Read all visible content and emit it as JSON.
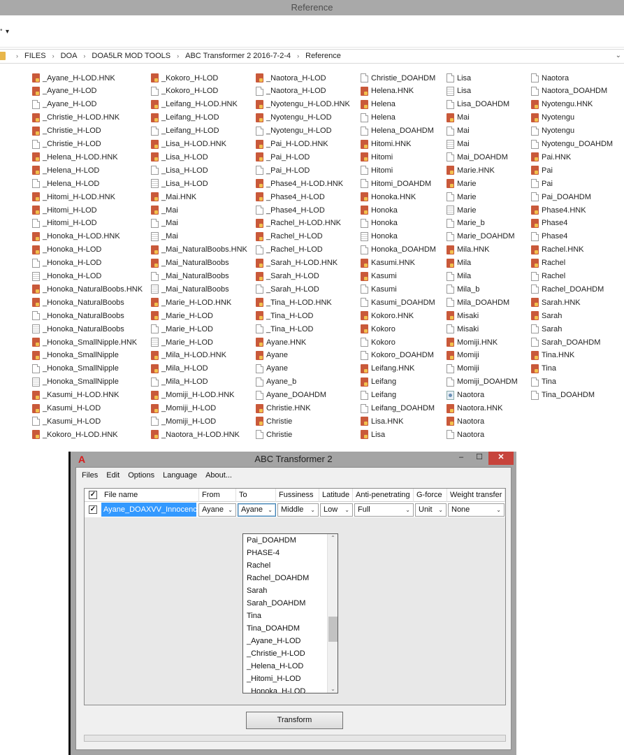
{
  "explorer": {
    "title": "Reference",
    "breadcrumb": [
      "FILES",
      "DOA",
      "DOA5LR MOD TOOLS",
      "ABC Transformer 2 2016-7-2-4",
      "Reference"
    ]
  },
  "files": [
    [
      {
        "name": "_Ayane_H-LOD.HNK",
        "icon": "hnk"
      },
      {
        "name": "_Ayane_H-LOD",
        "icon": "hnk"
      },
      {
        "name": "_Ayane_H-LOD",
        "icon": "file"
      },
      {
        "name": "_Christie_H-LOD.HNK",
        "icon": "hnk"
      },
      {
        "name": "_Christie_H-LOD",
        "icon": "hnk"
      },
      {
        "name": "_Christie_H-LOD",
        "icon": "file"
      },
      {
        "name": "_Helena_H-LOD.HNK",
        "icon": "hnk"
      },
      {
        "name": "_Helena_H-LOD",
        "icon": "hnk"
      },
      {
        "name": "_Helena_H-LOD",
        "icon": "file"
      },
      {
        "name": "_Hitomi_H-LOD.HNK",
        "icon": "hnk"
      },
      {
        "name": "_Hitomi_H-LOD",
        "icon": "hnk"
      },
      {
        "name": "_Hitomi_H-LOD",
        "icon": "file"
      },
      {
        "name": "_Honoka_H-LOD.HNK",
        "icon": "hnk"
      },
      {
        "name": "_Honoka_H-LOD",
        "icon": "hnk"
      },
      {
        "name": "_Honoka_H-LOD",
        "icon": "file"
      },
      {
        "name": "_Honoka_H-LOD",
        "icon": "doc"
      },
      {
        "name": "_Honoka_NaturalBoobs.HNK",
        "icon": "hnk"
      },
      {
        "name": "_Honoka_NaturalBoobs",
        "icon": "hnk"
      },
      {
        "name": "_Honoka_NaturalBoobs",
        "icon": "file"
      },
      {
        "name": "_Honoka_NaturalBoobs",
        "icon": "doc"
      },
      {
        "name": "_Honoka_SmallNipple.HNK",
        "icon": "hnk"
      },
      {
        "name": "_Honoka_SmallNipple",
        "icon": "hnk"
      },
      {
        "name": "_Honoka_SmallNipple",
        "icon": "file"
      },
      {
        "name": "_Honoka_SmallNipple",
        "icon": "doc"
      },
      {
        "name": "_Kasumi_H-LOD.HNK",
        "icon": "hnk"
      },
      {
        "name": "_Kasumi_H-LOD",
        "icon": "hnk"
      },
      {
        "name": "_Kasumi_H-LOD",
        "icon": "file"
      },
      {
        "name": "_Kokoro_H-LOD.HNK",
        "icon": "hnk"
      }
    ],
    [
      {
        "name": "_Kokoro_H-LOD",
        "icon": "hnk"
      },
      {
        "name": "_Kokoro_H-LOD",
        "icon": "file"
      },
      {
        "name": "_Leifang_H-LOD.HNK",
        "icon": "hnk"
      },
      {
        "name": "_Leifang_H-LOD",
        "icon": "hnk"
      },
      {
        "name": "_Leifang_H-LOD",
        "icon": "file"
      },
      {
        "name": "_Lisa_H-LOD.HNK",
        "icon": "hnk"
      },
      {
        "name": "_Lisa_H-LOD",
        "icon": "hnk"
      },
      {
        "name": "_Lisa_H-LOD",
        "icon": "file"
      },
      {
        "name": "_Lisa_H-LOD",
        "icon": "doc"
      },
      {
        "name": "_Mai.HNK",
        "icon": "hnk"
      },
      {
        "name": "_Mai",
        "icon": "hnk"
      },
      {
        "name": "_Mai",
        "icon": "file"
      },
      {
        "name": "_Mai",
        "icon": "doc"
      },
      {
        "name": "_Mai_NaturalBoobs.HNK",
        "icon": "hnk"
      },
      {
        "name": "_Mai_NaturalBoobs",
        "icon": "hnk"
      },
      {
        "name": "_Mai_NaturalBoobs",
        "icon": "file"
      },
      {
        "name": "_Mai_NaturalBoobs",
        "icon": "doc"
      },
      {
        "name": "_Marie_H-LOD.HNK",
        "icon": "hnk"
      },
      {
        "name": "_Marie_H-LOD",
        "icon": "hnk"
      },
      {
        "name": "_Marie_H-LOD",
        "icon": "file"
      },
      {
        "name": "_Marie_H-LOD",
        "icon": "doc"
      },
      {
        "name": "_Mila_H-LOD.HNK",
        "icon": "hnk"
      },
      {
        "name": "_Mila_H-LOD",
        "icon": "hnk"
      },
      {
        "name": "_Mila_H-LOD",
        "icon": "file"
      },
      {
        "name": "_Momiji_H-LOD.HNK",
        "icon": "hnk"
      },
      {
        "name": "_Momiji_H-LOD",
        "icon": "hnk"
      },
      {
        "name": "_Momiji_H-LOD",
        "icon": "file"
      },
      {
        "name": "_Naotora_H-LOD.HNK",
        "icon": "hnk"
      }
    ],
    [
      {
        "name": "_Naotora_H-LOD",
        "icon": "hnk"
      },
      {
        "name": "_Naotora_H-LOD",
        "icon": "file"
      },
      {
        "name": "_Nyotengu_H-LOD.HNK",
        "icon": "hnk"
      },
      {
        "name": "_Nyotengu_H-LOD",
        "icon": "hnk"
      },
      {
        "name": "_Nyotengu_H-LOD",
        "icon": "file"
      },
      {
        "name": "_Pai_H-LOD.HNK",
        "icon": "hnk"
      },
      {
        "name": "_Pai_H-LOD",
        "icon": "hnk"
      },
      {
        "name": "_Pai_H-LOD",
        "icon": "file"
      },
      {
        "name": "_Phase4_H-LOD.HNK",
        "icon": "hnk"
      },
      {
        "name": "_Phase4_H-LOD",
        "icon": "hnk"
      },
      {
        "name": "_Phase4_H-LOD",
        "icon": "file"
      },
      {
        "name": "_Rachel_H-LOD.HNK",
        "icon": "hnk"
      },
      {
        "name": "_Rachel_H-LOD",
        "icon": "hnk"
      },
      {
        "name": "_Rachel_H-LOD",
        "icon": "file"
      },
      {
        "name": "_Sarah_H-LOD.HNK",
        "icon": "hnk"
      },
      {
        "name": "_Sarah_H-LOD",
        "icon": "hnk"
      },
      {
        "name": "_Sarah_H-LOD",
        "icon": "file"
      },
      {
        "name": "_Tina_H-LOD.HNK",
        "icon": "hnk"
      },
      {
        "name": "_Tina_H-LOD",
        "icon": "hnk"
      },
      {
        "name": "_Tina_H-LOD",
        "icon": "file"
      },
      {
        "name": "Ayane.HNK",
        "icon": "hnk"
      },
      {
        "name": "Ayane",
        "icon": "hnk"
      },
      {
        "name": "Ayane",
        "icon": "file"
      },
      {
        "name": "Ayane_b",
        "icon": "file"
      },
      {
        "name": "Ayane_DOAHDM",
        "icon": "file"
      },
      {
        "name": "Christie.HNK",
        "icon": "hnk"
      },
      {
        "name": "Christie",
        "icon": "hnk"
      },
      {
        "name": "Christie",
        "icon": "file"
      }
    ],
    [
      {
        "name": "Christie_DOAHDM",
        "icon": "file"
      },
      {
        "name": "Helena.HNK",
        "icon": "hnk"
      },
      {
        "name": "Helena",
        "icon": "hnk"
      },
      {
        "name": "Helena",
        "icon": "file"
      },
      {
        "name": "Helena_DOAHDM",
        "icon": "file"
      },
      {
        "name": "Hitomi.HNK",
        "icon": "hnk"
      },
      {
        "name": "Hitomi",
        "icon": "hnk"
      },
      {
        "name": "Hitomi",
        "icon": "file"
      },
      {
        "name": "Hitomi_DOAHDM",
        "icon": "file"
      },
      {
        "name": "Honoka.HNK",
        "icon": "hnk"
      },
      {
        "name": "Honoka",
        "icon": "hnk"
      },
      {
        "name": "Honoka",
        "icon": "file"
      },
      {
        "name": "Honoka",
        "icon": "doc"
      },
      {
        "name": "Honoka_DOAHDM",
        "icon": "file"
      },
      {
        "name": "Kasumi.HNK",
        "icon": "hnk"
      },
      {
        "name": "Kasumi",
        "icon": "hnk"
      },
      {
        "name": "Kasumi",
        "icon": "file"
      },
      {
        "name": "Kasumi_DOAHDM",
        "icon": "file"
      },
      {
        "name": "Kokoro.HNK",
        "icon": "hnk"
      },
      {
        "name": "Kokoro",
        "icon": "hnk"
      },
      {
        "name": "Kokoro",
        "icon": "file"
      },
      {
        "name": "Kokoro_DOAHDM",
        "icon": "file"
      },
      {
        "name": "Leifang.HNK",
        "icon": "hnk"
      },
      {
        "name": "Leifang",
        "icon": "hnk"
      },
      {
        "name": "Leifang",
        "icon": "file"
      },
      {
        "name": "Leifang_DOAHDM",
        "icon": "file"
      },
      {
        "name": "Lisa.HNK",
        "icon": "hnk"
      },
      {
        "name": "Lisa",
        "icon": "hnk"
      }
    ],
    [
      {
        "name": "Lisa",
        "icon": "file"
      },
      {
        "name": "Lisa",
        "icon": "doc"
      },
      {
        "name": "Lisa_DOAHDM",
        "icon": "file"
      },
      {
        "name": "Mai",
        "icon": "hnk"
      },
      {
        "name": "Mai",
        "icon": "file"
      },
      {
        "name": "Mai",
        "icon": "doc"
      },
      {
        "name": "Mai_DOAHDM",
        "icon": "file"
      },
      {
        "name": "Marie.HNK",
        "icon": "hnk"
      },
      {
        "name": "Marie",
        "icon": "hnk"
      },
      {
        "name": "Marie",
        "icon": "file"
      },
      {
        "name": "Marie",
        "icon": "doc"
      },
      {
        "name": "Marie_b",
        "icon": "file"
      },
      {
        "name": "Marie_DOAHDM",
        "icon": "file"
      },
      {
        "name": "Mila.HNK",
        "icon": "hnk"
      },
      {
        "name": "Mila",
        "icon": "hnk"
      },
      {
        "name": "Mila",
        "icon": "file"
      },
      {
        "name": "Mila_b",
        "icon": "file"
      },
      {
        "name": "Mila_DOAHDM",
        "icon": "file"
      },
      {
        "name": "Misaki",
        "icon": "hnk"
      },
      {
        "name": "Misaki",
        "icon": "file"
      },
      {
        "name": "Momiji.HNK",
        "icon": "hnk"
      },
      {
        "name": "Momiji",
        "icon": "hnk"
      },
      {
        "name": "Momiji",
        "icon": "file"
      },
      {
        "name": "Momiji_DOAHDM",
        "icon": "file"
      },
      {
        "name": "Naotora",
        "icon": "img"
      },
      {
        "name": "Naotora.HNK",
        "icon": "hnk"
      },
      {
        "name": "Naotora",
        "icon": "hnk"
      },
      {
        "name": "Naotora",
        "icon": "file"
      }
    ],
    [
      {
        "name": "Naotora",
        "icon": "file"
      },
      {
        "name": "Naotora_DOAHDM",
        "icon": "file"
      },
      {
        "name": "Nyotengu.HNK",
        "icon": "hnk"
      },
      {
        "name": "Nyotengu",
        "icon": "hnk"
      },
      {
        "name": "Nyotengu",
        "icon": "file"
      },
      {
        "name": "Nyotengu_DOAHDM",
        "icon": "file"
      },
      {
        "name": "Pai.HNK",
        "icon": "hnk"
      },
      {
        "name": "Pai",
        "icon": "hnk"
      },
      {
        "name": "Pai",
        "icon": "file"
      },
      {
        "name": "Pai_DOAHDM",
        "icon": "file"
      },
      {
        "name": "Phase4.HNK",
        "icon": "hnk"
      },
      {
        "name": "Phase4",
        "icon": "hnk"
      },
      {
        "name": "Phase4",
        "icon": "file"
      },
      {
        "name": "Rachel.HNK",
        "icon": "hnk"
      },
      {
        "name": "Rachel",
        "icon": "hnk"
      },
      {
        "name": "Rachel",
        "icon": "file"
      },
      {
        "name": "Rachel_DOAHDM",
        "icon": "file"
      },
      {
        "name": "Sarah.HNK",
        "icon": "hnk"
      },
      {
        "name": "Sarah",
        "icon": "hnk"
      },
      {
        "name": "Sarah",
        "icon": "file"
      },
      {
        "name": "Sarah_DOAHDM",
        "icon": "file"
      },
      {
        "name": "Tina.HNK",
        "icon": "hnk"
      },
      {
        "name": "Tina",
        "icon": "hnk"
      },
      {
        "name": "Tina",
        "icon": "file"
      },
      {
        "name": "Tina_DOAHDM",
        "icon": "file"
      }
    ]
  ],
  "app": {
    "title": "ABC Transformer 2",
    "logo": "A",
    "window_buttons": {
      "minimize": "–",
      "maximize": "☐",
      "close": "✕"
    },
    "menu": [
      "Files",
      "Edit",
      "Options",
      "Language",
      "About..."
    ],
    "columns": [
      "File name",
      "From",
      "To",
      "Fussiness",
      "Latitude",
      "Anti-penetrating",
      "G-force",
      "Weight transfer"
    ],
    "row": {
      "checked": true,
      "file_name": "Ayane_DOAXVV_Innocence.",
      "from": "Ayane",
      "to": "Ayane",
      "fussiness": "Middle",
      "latitude": "Low",
      "anti_penetrating": "Full",
      "g_force": "Unit",
      "weight_transfer": "None"
    },
    "to_options": [
      "Pai_DOAHDM",
      "PHASE-4",
      "Rachel",
      "Rachel_DOAHDM",
      "Sarah",
      "Sarah_DOAHDM",
      "Tina",
      "Tina_DOAHDM",
      "_Ayane_H-LOD",
      "_Christie_H-LOD",
      "_Helena_H-LOD",
      "_Hitomi_H-LOD",
      "_Honoka_H-LOD"
    ],
    "transform_button": "Transform",
    "progress": 0
  }
}
